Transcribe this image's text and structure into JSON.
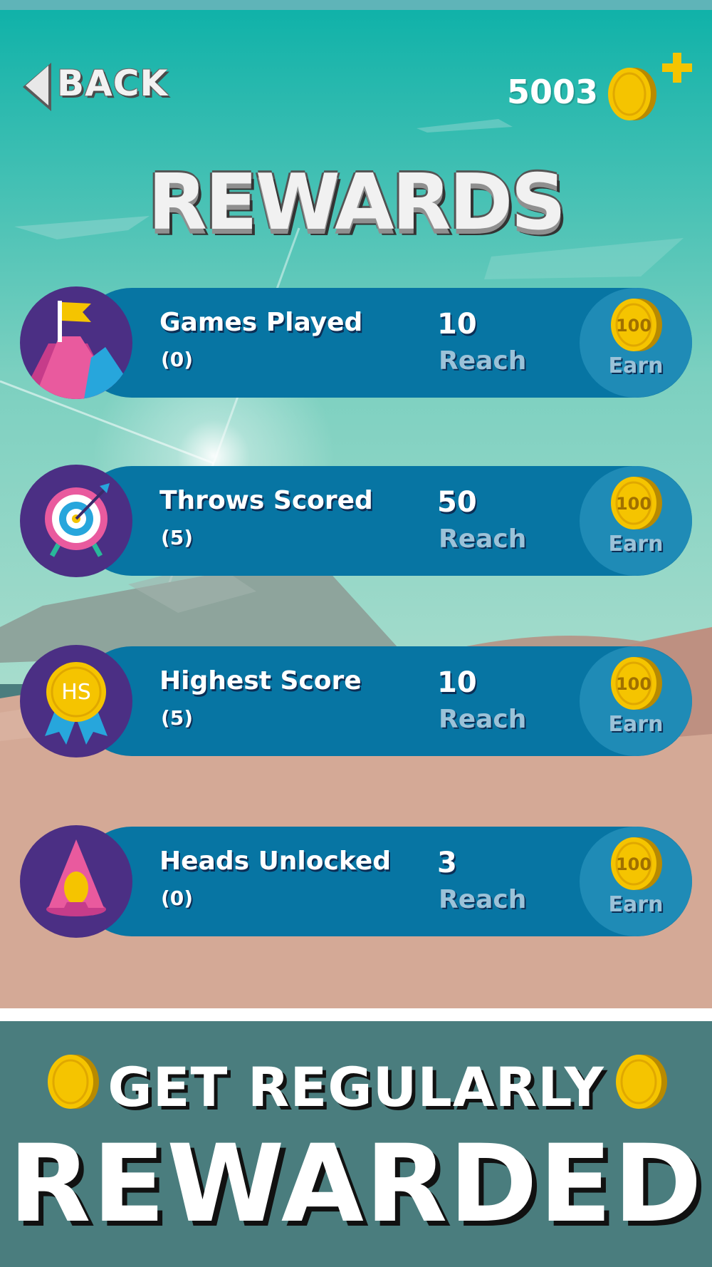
{
  "header": {
    "back_label": "BACK",
    "coin_balance": "5003",
    "title": "REWARDS"
  },
  "rewards": [
    {
      "name": "Games Played",
      "progress": "(0)",
      "target": "10",
      "reach_label": "Reach",
      "coin_value": "100",
      "earn_label": "Earn",
      "icon": "mountain-flag-icon"
    },
    {
      "name": "Throws Scored",
      "progress": "(5)",
      "target": "50",
      "reach_label": "Reach",
      "coin_value": "100",
      "earn_label": "Earn",
      "icon": "target-arrow-icon"
    },
    {
      "name": "Highest Score",
      "progress": "(5)",
      "target": "10",
      "reach_label": "Reach",
      "coin_value": "100",
      "earn_label": "Earn",
      "icon": "hs-medal-icon",
      "icon_text": "HS"
    },
    {
      "name": "Heads Unlocked",
      "progress": "(0)",
      "target": "3",
      "reach_label": "Reach",
      "coin_value": "100",
      "earn_label": "Earn",
      "icon": "hooded-head-icon"
    }
  ],
  "promo": {
    "line1": "GET REGULARLY",
    "line2": "REWARDED"
  },
  "colors": {
    "sky_top": "#0db1a8",
    "sky_bottom": "#a6dccc",
    "ground": "#d4a996",
    "row_band": "#0775a3",
    "earn_button": "#1f8bb6",
    "icon_circle": "#4b2f84",
    "coin": "#f5c400",
    "promo_bg": "#4a7d7e"
  }
}
